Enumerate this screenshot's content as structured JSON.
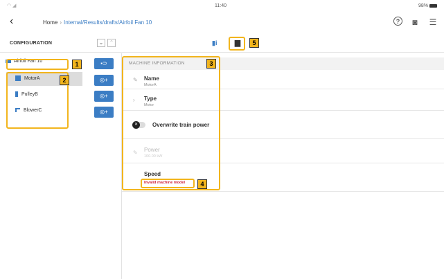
{
  "statusbar": {
    "time": "11:40",
    "battery": "98%"
  },
  "breadcrumb": {
    "home": "Home",
    "separator": "›",
    "path": "Internal/Results/drafts/Airfoil Fan 10"
  },
  "config": {
    "title": "CONFIGURATION"
  },
  "tree": {
    "root": "Airfoil Fan 10",
    "items": [
      {
        "label": "MotorA",
        "icon": "motor-icon"
      },
      {
        "label": "PulleyB",
        "icon": "pulley-icon"
      },
      {
        "label": "BlowerC",
        "icon": "blower-icon"
      }
    ]
  },
  "machine_info": {
    "section_title": "MACHINE INFORMATION",
    "name_label": "Name",
    "name_value": "MotorA",
    "type_label": "Type",
    "type_value": "Motor",
    "overwrite_label": "Overwrite train power",
    "power_label": "Power",
    "power_value": "100.00 kW",
    "speed_label": "Speed",
    "speed_error": "Invalid machine model"
  },
  "callouts": [
    "1",
    "2",
    "3",
    "4",
    "5"
  ],
  "colors": {
    "accent": "#3b7dc4",
    "highlight": "#f2b51d",
    "error": "#d0243c"
  }
}
